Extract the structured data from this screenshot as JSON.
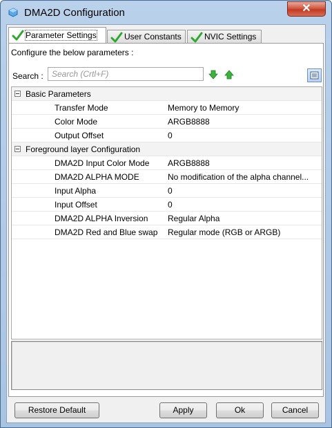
{
  "window": {
    "title": "DMA2D Configuration",
    "close_glyph": "✕",
    "title_icon": "cube-icon"
  },
  "tabs": [
    {
      "label": "Parameter Settings",
      "active": true,
      "icon": "check-icon"
    },
    {
      "label": "User Constants",
      "active": false,
      "icon": "check-icon"
    },
    {
      "label": "NVIC Settings",
      "active": false,
      "icon": "check-icon"
    }
  ],
  "panel": {
    "configure_text": "Configure the below parameters :",
    "search_label": "Search :",
    "search_placeholder": "Search (Crtl+F)",
    "search_value": ""
  },
  "groups": [
    {
      "label": "Basic Parameters",
      "params": [
        {
          "name": "Transfer Mode",
          "value": "Memory to Memory"
        },
        {
          "name": "Color Mode",
          "value": "ARGB8888"
        },
        {
          "name": "Output Offset",
          "value": "0"
        }
      ]
    },
    {
      "label": "Foreground layer Configuration",
      "params": [
        {
          "name": "DMA2D Input Color Mode",
          "value": "ARGB8888"
        },
        {
          "name": "DMA2D ALPHA MODE",
          "value": "No modification of the alpha channel..."
        },
        {
          "name": "Input Alpha",
          "value": "0"
        },
        {
          "name": "Input Offset",
          "value": "0"
        },
        {
          "name": "DMA2D ALPHA Inversion",
          "value": "Regular Alpha"
        },
        {
          "name": "DMA2D Red and Blue swap",
          "value": "Regular mode (RGB or ARGB)"
        }
      ]
    }
  ],
  "buttons": {
    "restore_default": "Restore Default",
    "apply": "Apply",
    "ok": "Ok",
    "cancel": "Cancel"
  },
  "colors": {
    "titlebar": "#b9d1ea",
    "close_button": "#c33a22",
    "check_green": "#2fa82f",
    "arrow_green": "#3cb43c",
    "group_row": "#f3f3f3"
  }
}
